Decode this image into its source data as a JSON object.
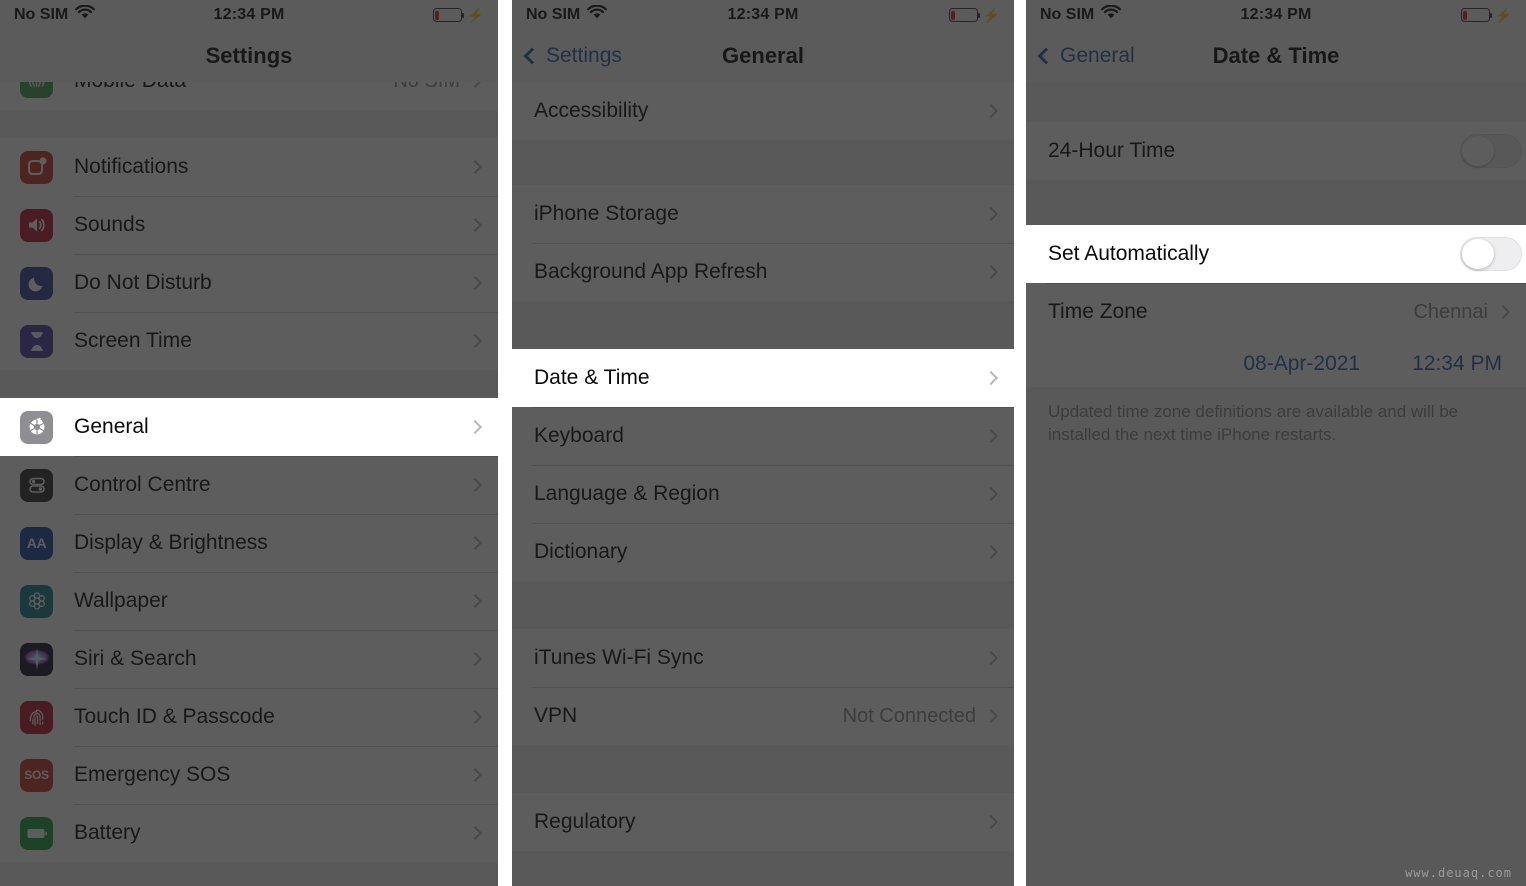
{
  "status_bar": {
    "carrier": "No SIM",
    "wifi_icon": "wifi-icon",
    "time": "12:34 PM",
    "battery_icon": "battery-low-icon",
    "battery_percent": 15,
    "charging_icon": "lightning-bolt-icon"
  },
  "colors": {
    "accent_blue": "#2b5fad",
    "list_bg": "#efeff4",
    "row_bg": "#ffffff",
    "separator": "#d4d4d8",
    "value_gray": "#8b8b90",
    "scrim": "rgba(30,30,30,0.72)"
  },
  "watermark": "www.deuaq.com",
  "panel_1": {
    "nav": {
      "title": "Settings"
    },
    "rows_top": [
      {
        "label": "Mobile Data",
        "value": "No SIM",
        "icon": "mobile-data-icon",
        "icon_class": "ic-mobile",
        "glyph": "((|))"
      }
    ],
    "group_a": [
      {
        "label": "Notifications",
        "icon": "notifications-icon",
        "icon_class": "ic-notif",
        "glyph": "▢"
      },
      {
        "label": "Sounds",
        "icon": "sounds-icon",
        "icon_class": "ic-sounds",
        "glyph": "🔊"
      },
      {
        "label": "Do Not Disturb",
        "icon": "do-not-disturb-icon",
        "icon_class": "ic-dnd",
        "glyph": "☽"
      },
      {
        "label": "Screen Time",
        "icon": "screen-time-icon",
        "icon_class": "ic-screen",
        "glyph": "⌛"
      }
    ],
    "group_b": [
      {
        "label": "General",
        "icon": "gear-icon",
        "icon_class": "ic-general",
        "glyph": "⚙",
        "spotlight": true
      },
      {
        "label": "Control Centre",
        "icon": "control-centre-icon",
        "icon_class": "ic-control",
        "glyph": "≡"
      },
      {
        "label": "Display & Brightness",
        "icon": "display-brightness-icon",
        "icon_class": "ic-display",
        "glyph": "AA"
      },
      {
        "label": "Wallpaper",
        "icon": "wallpaper-icon",
        "icon_class": "ic-wall",
        "glyph": "❋"
      },
      {
        "label": "Siri & Search",
        "icon": "siri-icon",
        "icon_class": "ic-siri",
        "glyph": "✴"
      },
      {
        "label": "Touch ID & Passcode",
        "icon": "touch-id-icon",
        "icon_class": "ic-touch",
        "glyph": "◎"
      },
      {
        "label": "Emergency SOS",
        "icon": "emergency-sos-icon",
        "icon_class": "ic-sos",
        "glyph": "SOS"
      },
      {
        "label": "Battery",
        "icon": "battery-icon",
        "icon_class": "ic-batt",
        "glyph": "▬"
      }
    ]
  },
  "panel_2": {
    "nav": {
      "back_label": "Settings",
      "title": "General"
    },
    "group_a": [
      {
        "label": "Accessibility"
      }
    ],
    "group_b": [
      {
        "label": "iPhone Storage"
      },
      {
        "label": "Background App Refresh"
      }
    ],
    "group_c": [
      {
        "label": "Date & Time",
        "spotlight": true
      },
      {
        "label": "Keyboard"
      },
      {
        "label": "Language & Region"
      },
      {
        "label": "Dictionary"
      }
    ],
    "group_d": [
      {
        "label": "iTunes Wi-Fi Sync"
      },
      {
        "label": "VPN",
        "value": "Not Connected"
      }
    ],
    "group_e": [
      {
        "label": "Regulatory"
      }
    ]
  },
  "panel_3": {
    "nav": {
      "back_label": "General",
      "title": "Date & Time"
    },
    "group_a": [
      {
        "label": "24-Hour Time",
        "toggle": "off"
      }
    ],
    "group_b": [
      {
        "label": "Set Automatically",
        "toggle": "off",
        "spotlight": true
      },
      {
        "label": "Time Zone",
        "value": "Chennai"
      }
    ],
    "datetime": {
      "date": "08-Apr-2021",
      "time": "12:34 PM"
    },
    "footnote": "Updated time zone definitions are available and will be installed the next time iPhone restarts."
  }
}
